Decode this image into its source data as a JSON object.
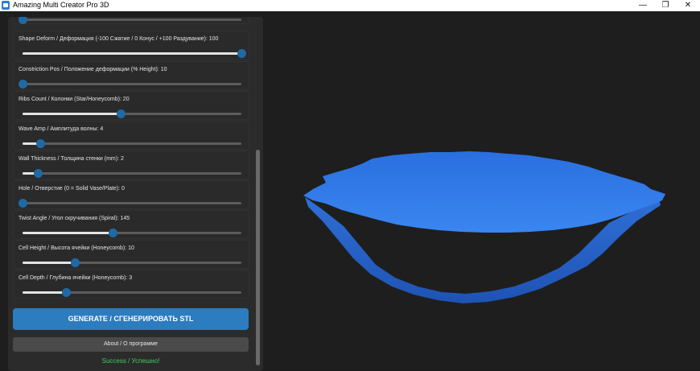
{
  "window": {
    "title": "Amazing Multi Creator Pro 3D",
    "min_glyph": "—",
    "restore_glyph": "❐",
    "close_glyph": "✕"
  },
  "sliders": [
    {
      "label": "",
      "value": 0.0
    },
    {
      "label": "Shape Deform / Деформация (-100 Сжатие / 0 Конус / +100 Раздувание): 100",
      "value": 1.0
    },
    {
      "label": "Constriction Pos / Положение деформации (% Height): 10",
      "value": 0.0
    },
    {
      "label": "Ribs Count / Колонки (Star/Honeycomb): 20",
      "value": 0.45
    },
    {
      "label": "Wave Amp / Амплитуда волны: 4",
      "value": 0.08
    },
    {
      "label": "Wall Thickness / Толщина стенки (mm): 2",
      "value": 0.07
    },
    {
      "label": "Hole / Отверстие (0 = Solid Vase/Plate): 0",
      "value": 0.0
    },
    {
      "label": "Twist Angle / Угол скручивания (Spiral): 145",
      "value": 0.41
    },
    {
      "label": "Cell Height / Высота ячейки (Honeycomb): 10",
      "value": 0.24
    },
    {
      "label": "Cell Depth / Глубина ячейки (Honeycomb): 3",
      "value": 0.2
    }
  ],
  "buttons": {
    "generate": "GENERATE / СГЕНЕРИРОВАТЬ STL",
    "about": "About / О программе"
  },
  "status": "Success / Успешно!",
  "colors": {
    "accent": "#1f6aa5",
    "generate_button": "#2c7cc0",
    "success": "#3ecf5e",
    "model": "#2f6fd6"
  }
}
